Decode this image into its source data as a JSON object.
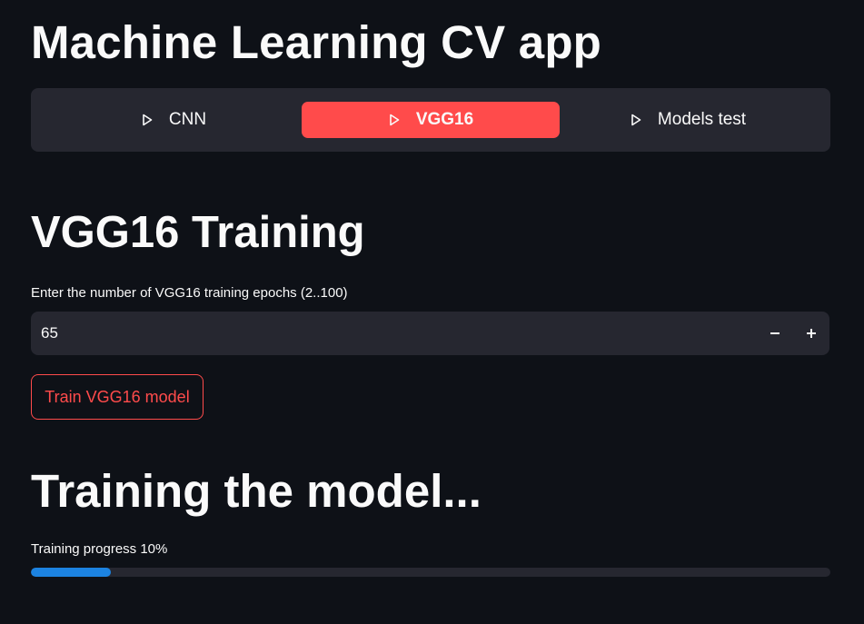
{
  "app": {
    "title": "Machine Learning CV app"
  },
  "nav": {
    "items": [
      {
        "label": "CNN",
        "icon": "play-outline-icon",
        "active": false
      },
      {
        "label": "VGG16",
        "icon": "play-outline-icon",
        "active": true
      },
      {
        "label": "Models test",
        "icon": "play-outline-icon",
        "active": false
      }
    ]
  },
  "training": {
    "section_title": "VGG16 Training",
    "epochs_label": "Enter the number of VGG16 training epochs (2..100)",
    "epochs_value": "65",
    "decrement_icon": "minus-icon",
    "increment_icon": "plus-icon",
    "train_button_label": "Train VGG16 model"
  },
  "status": {
    "title": "Training the model...",
    "progress_label": "Training progress 10%",
    "progress_fraction": 0.1
  },
  "colors": {
    "background": "#0e1117",
    "surface": "#262730",
    "accent": "#ff4b4b",
    "progress": "#1c83e1",
    "text": "#fafafa"
  }
}
